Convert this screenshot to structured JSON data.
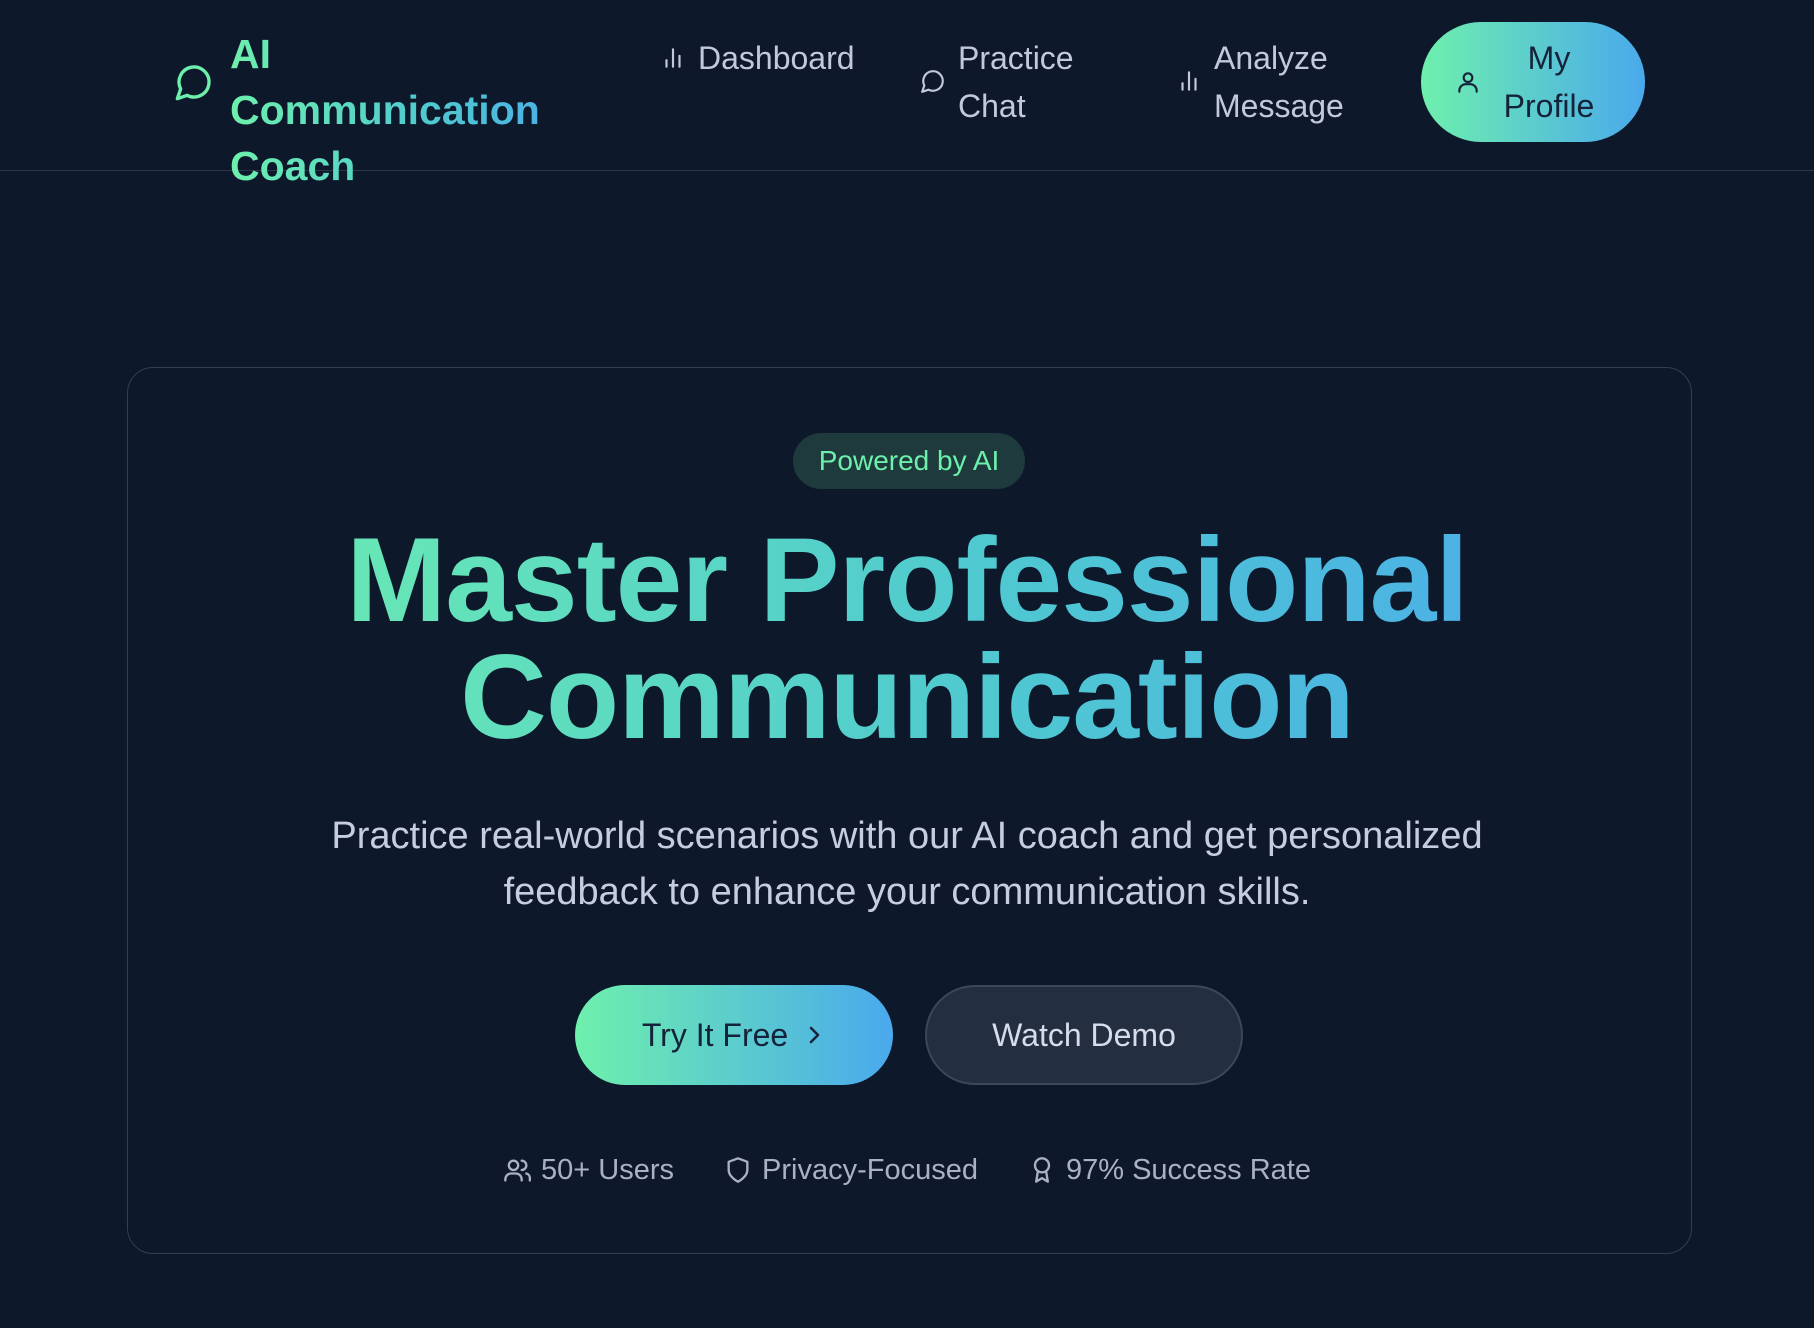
{
  "nav": {
    "brand_line1": "AI Communication",
    "brand_line2": "Coach",
    "dashboard": "Dashboard",
    "practice_line1": "Practice",
    "practice_line2": "Chat",
    "analyze_line1": "Analyze",
    "analyze_line2": "Message",
    "profile_line1": "My",
    "profile_line2": "Profile"
  },
  "hero": {
    "badge": "Powered by AI",
    "headline_line1": "Master Professional",
    "headline_line2": "Communication",
    "subtitle_line1": "Practice real-world scenarios with our AI coach and get personalized",
    "subtitle_line2": "feedback to enhance your communication skills.",
    "primary_cta": "Try It Free",
    "secondary_cta": "Watch Demo"
  },
  "stats": [
    {
      "icon": "users-icon",
      "label": "50+ Users"
    },
    {
      "icon": "shield-icon",
      "label": "Privacy-Focused"
    },
    {
      "icon": "award-icon",
      "label": "97% Success Rate"
    }
  ],
  "colors": {
    "background": "#0e182b",
    "accent_green": "#6ef0ad",
    "accent_blue": "#4aa9ec",
    "card_border": "#323e52"
  }
}
